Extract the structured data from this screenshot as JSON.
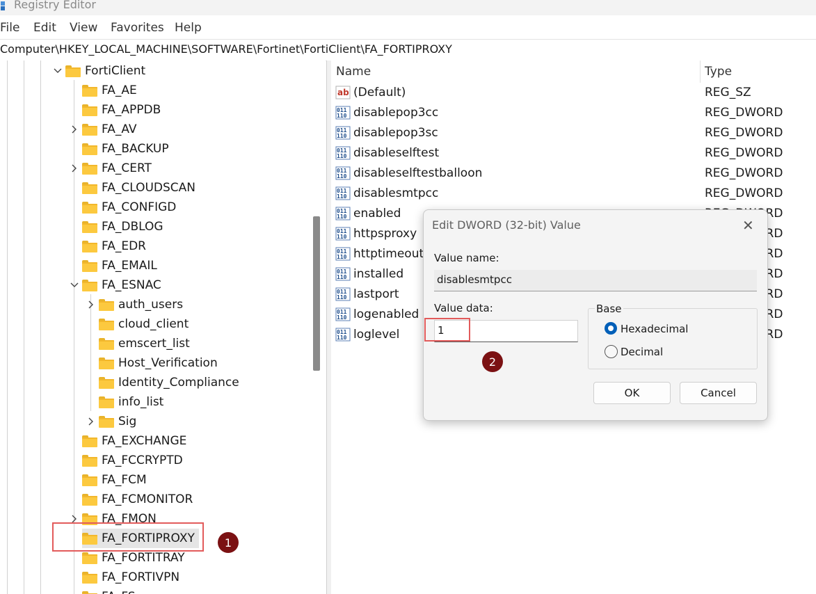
{
  "window": {
    "title": "Registry Editor"
  },
  "menu": [
    "File",
    "Edit",
    "View",
    "Favorites",
    "Help"
  ],
  "address": "Computer\\HKEY_LOCAL_MACHINE\\SOFTWARE\\Fortinet\\FortiClient\\FA_FORTIPROXY",
  "tree": [
    {
      "label": "FortiClient",
      "depth": 0,
      "expander": "expanded"
    },
    {
      "label": "FA_AE",
      "depth": 1,
      "expander": "none"
    },
    {
      "label": "FA_APPDB",
      "depth": 1,
      "expander": "none"
    },
    {
      "label": "FA_AV",
      "depth": 1,
      "expander": "collapsed"
    },
    {
      "label": "FA_BACKUP",
      "depth": 1,
      "expander": "none"
    },
    {
      "label": "FA_CERT",
      "depth": 1,
      "expander": "collapsed"
    },
    {
      "label": "FA_CLOUDSCAN",
      "depth": 1,
      "expander": "none"
    },
    {
      "label": "FA_CONFIGD",
      "depth": 1,
      "expander": "none"
    },
    {
      "label": "FA_DBLOG",
      "depth": 1,
      "expander": "none"
    },
    {
      "label": "FA_EDR",
      "depth": 1,
      "expander": "none"
    },
    {
      "label": "FA_EMAIL",
      "depth": 1,
      "expander": "none"
    },
    {
      "label": "FA_ESNAC",
      "depth": 1,
      "expander": "expanded"
    },
    {
      "label": "auth_users",
      "depth": 2,
      "expander": "collapsed"
    },
    {
      "label": "cloud_client",
      "depth": 2,
      "expander": "none"
    },
    {
      "label": "emscert_list",
      "depth": 2,
      "expander": "none"
    },
    {
      "label": "Host_Verification",
      "depth": 2,
      "expander": "none"
    },
    {
      "label": "Identity_Compliance",
      "depth": 2,
      "expander": "none"
    },
    {
      "label": "info_list",
      "depth": 2,
      "expander": "none"
    },
    {
      "label": "Sig",
      "depth": 2,
      "expander": "collapsed"
    },
    {
      "label": "FA_EXCHANGE",
      "depth": 1,
      "expander": "none"
    },
    {
      "label": "FA_FCCRYPTD",
      "depth": 1,
      "expander": "none"
    },
    {
      "label": "FA_FCM",
      "depth": 1,
      "expander": "none"
    },
    {
      "label": "FA_FCMONITOR",
      "depth": 1,
      "expander": "none"
    },
    {
      "label": "FA_FMON",
      "depth": 1,
      "expander": "collapsed"
    },
    {
      "label": "FA_FORTIPROXY",
      "depth": 1,
      "expander": "none",
      "selected": true
    },
    {
      "label": "FA_FORTITRAY",
      "depth": 1,
      "expander": "none"
    },
    {
      "label": "FA_FORTIVPN",
      "depth": 1,
      "expander": "none"
    },
    {
      "label": "FA_FS",
      "depth": 1,
      "expander": "none"
    }
  ],
  "list": {
    "headers": {
      "name": "Name",
      "type": "Type"
    },
    "rows": [
      {
        "name": "(Default)",
        "type": "REG_SZ",
        "icon": "string-value-icon"
      },
      {
        "name": "disablepop3cc",
        "type": "REG_DWORD",
        "icon": "binary-value-icon"
      },
      {
        "name": "disablepop3sc",
        "type": "REG_DWORD",
        "icon": "binary-value-icon"
      },
      {
        "name": "disableselftest",
        "type": "REG_DWORD",
        "icon": "binary-value-icon"
      },
      {
        "name": "disableselftestballoon",
        "type": "REG_DWORD",
        "icon": "binary-value-icon"
      },
      {
        "name": "disablesmtpcc",
        "type": "REG_DWORD",
        "icon": "binary-value-icon"
      },
      {
        "name": "enabled",
        "type": "REG_DWORD",
        "icon": "binary-value-icon"
      },
      {
        "name": "httpsproxy",
        "type": "REG_DWORD",
        "icon": "binary-value-icon"
      },
      {
        "name": "httptimeout",
        "type": "REG_DWORD",
        "icon": "binary-value-icon"
      },
      {
        "name": "installed",
        "type": "REG_DWORD",
        "icon": "binary-value-icon"
      },
      {
        "name": "lastport",
        "type": "REG_DWORD",
        "icon": "binary-value-icon"
      },
      {
        "name": "logenabled",
        "type": "REG_DWORD",
        "icon": "binary-value-icon"
      },
      {
        "name": "loglevel",
        "type": "REG_DWORD",
        "icon": "binary-value-icon"
      }
    ]
  },
  "dialog": {
    "title": "Edit DWORD (32-bit) Value",
    "close_glyph": "✕",
    "value_name_label": "Value name:",
    "value_name": "disablesmtpcc",
    "value_data_label": "Value data:",
    "value_data": "1",
    "base_label": "Base",
    "base_options": [
      "Hexadecimal",
      "Decimal"
    ],
    "base_selected": "Hexadecimal",
    "ok_label": "OK",
    "cancel_label": "Cancel"
  },
  "annotations": {
    "step1": "1",
    "step2": "2",
    "color": "#7b1113",
    "box_color": "#e25b5b"
  }
}
